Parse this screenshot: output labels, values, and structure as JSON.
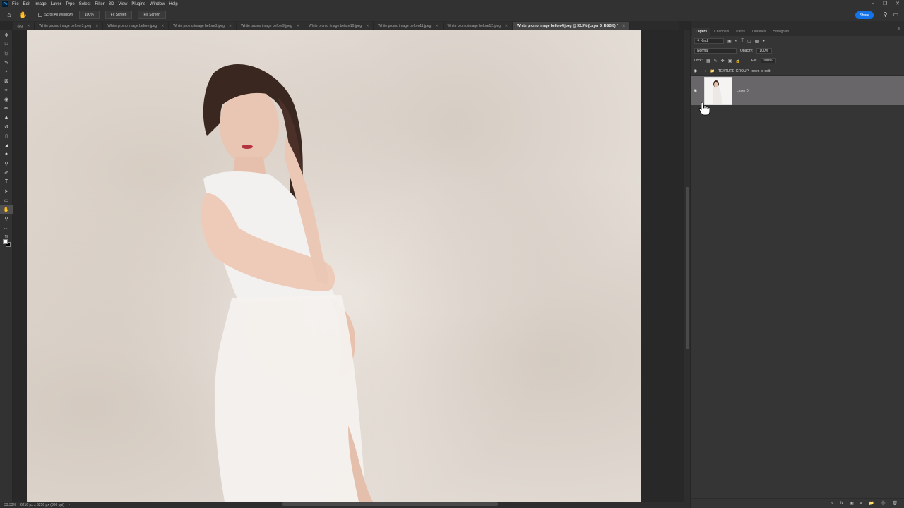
{
  "menu": {
    "logo": "Ps",
    "items": [
      "File",
      "Edit",
      "Image",
      "Layer",
      "Type",
      "Select",
      "Filter",
      "3D",
      "View",
      "Plugins",
      "Window",
      "Help"
    ]
  },
  "options": {
    "scroll_all_label": "Scroll All Windows",
    "zoom_btn": "100%",
    "fit_btn": "Fit Screen",
    "fill_btn": "Fill Screen",
    "share_label": "Share"
  },
  "tabs": [
    {
      "label": ".jpg",
      "active": false
    },
    {
      "label": "White promo image before 3.jpeg",
      "active": false
    },
    {
      "label": "White promo image before.jpeg",
      "active": false
    },
    {
      "label": "White promo image before8.jpeg",
      "active": false
    },
    {
      "label": "White promo image before9.jpeg",
      "active": false
    },
    {
      "label": "White promo image before10.jpeg",
      "active": false
    },
    {
      "label": "White promo image before11.jpeg",
      "active": false
    },
    {
      "label": "White promo image before12.jpeg",
      "active": false
    },
    {
      "label": "White promo image before4.jpeg @ 33.3% (Layer 0, RGB/8) *",
      "active": true
    }
  ],
  "status": {
    "zoom": "33.33%",
    "doc_size": "6216 px x 6216 px (300 ppi)"
  },
  "panel": {
    "tabs": [
      "Layers",
      "Channels",
      "Paths",
      "Libraries",
      "Histogram"
    ],
    "filter_kind": "Kind",
    "blend_mode": "Normal",
    "opacity_label": "Opacity:",
    "opacity_value": "100%",
    "lock_label": "Lock:",
    "fill_label": "Fill:",
    "fill_value": "100%",
    "layers": [
      {
        "name": "TEXTURE GROUP - open to edit",
        "type": "group"
      },
      {
        "name": "Layer 0",
        "type": "image",
        "selected": true
      }
    ]
  }
}
